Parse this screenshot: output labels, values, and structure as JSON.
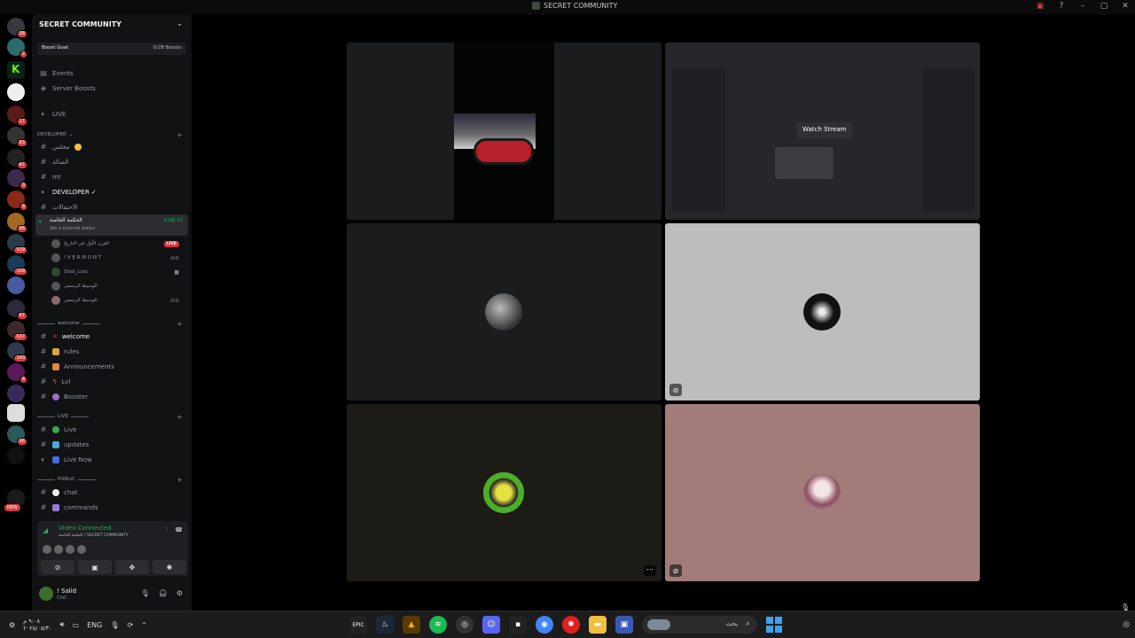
{
  "window": {
    "title": "SECRET COMMUNITY",
    "controls": [
      "–",
      "▢",
      "✕"
    ]
  },
  "server_rail": {
    "badges": [
      "38",
      "2",
      "",
      "17",
      "3",
      "83",
      "47",
      "9",
      "8",
      "68",
      "529",
      "109",
      "",
      "47",
      "637",
      "140",
      "8",
      "",
      "96",
      "",
      "",
      "NEW"
    ]
  },
  "sidebar": {
    "guild_name": "SECRET COMMUNITY",
    "boost": {
      "label": "Boost Goal",
      "progress": "0/28 Boosts"
    },
    "top_items": [
      "Events",
      "Server Boosts"
    ],
    "live_item": "LIVE",
    "developer_category": "DEVELOPER",
    "developer_channels": [
      "مجلس",
      "الصالة",
      "mt",
      "DEVELOPER ✓",
      "الاحتفالات"
    ],
    "active_voice": {
      "name": "الحكمة الخاصة",
      "status": "Set a channel status",
      "time": "0:08:33"
    },
    "voice_users": [
      {
        "name": "القرن الأول في التاريخ",
        "tag": "LIVE"
      },
      {
        "name": "! V E R M O N T",
        "tag": ""
      },
      {
        "name": "Shot_Lust",
        "tag": ""
      },
      {
        "name": "الوسيط الرسمي",
        "tag": ""
      },
      {
        "name": "الوسيط الرسمي",
        "tag": ""
      }
    ],
    "welcome_category": "welcome",
    "welcome_channels": [
      "welcome",
      "rules",
      "Announcements",
      "Lvl",
      "Booster"
    ],
    "live_category": "LIVE",
    "live_channels": [
      "Live",
      "updates",
      "Live Now"
    ],
    "public_category": "PUBLIC",
    "public_channels": [
      "chat",
      "commands"
    ],
    "voice_panel": {
      "title": "Video Connected",
      "subtitle": "الحكمة الخاصة / SECRET COMMUNITY"
    },
    "user": {
      "name": "! Salid",
      "status": "Chill"
    }
  },
  "video": {
    "watch_stream": "Watch Stream",
    "tiles": [
      {
        "id": "camera-feed",
        "bg": "#1b1c1e"
      },
      {
        "id": "stream",
        "bg": "#262729"
      },
      {
        "id": "user-1",
        "bg": "#1b1c1e"
      },
      {
        "id": "user-2",
        "bg": "#bdbdbd"
      },
      {
        "id": "user-3",
        "bg": "#1c1b16"
      },
      {
        "id": "user-4",
        "bg": "#a27c78"
      }
    ]
  },
  "taskbar": {
    "time": "٩:٠٨ م",
    "date": "٢٠٢٥/٠٥/٣٠",
    "lang": "ENG",
    "search_placeholder": "بحث"
  },
  "colors": {
    "accent_green": "#23a55a",
    "live_red": "#da373c"
  }
}
